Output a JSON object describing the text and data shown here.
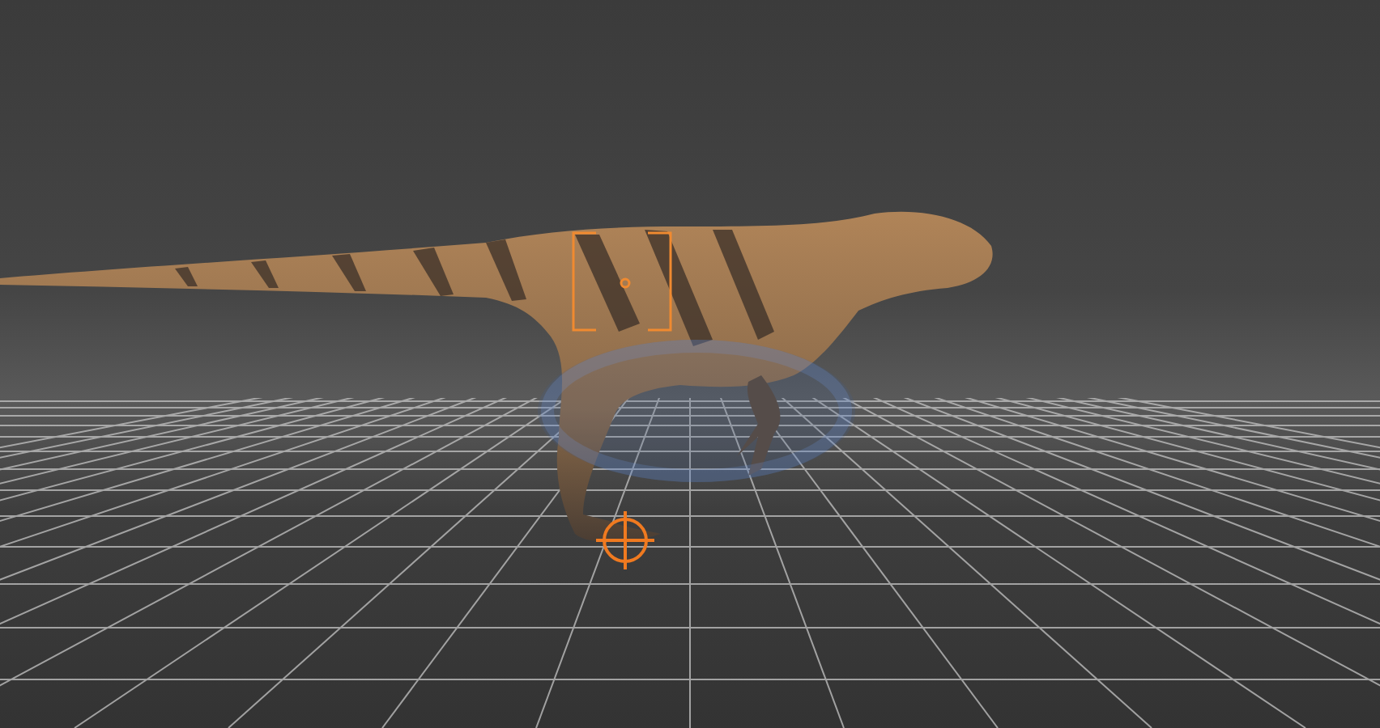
{
  "viewport": {
    "floor_grid": true,
    "selection_bracket": true,
    "rotation_gizmo": true,
    "foot_target": true
  }
}
